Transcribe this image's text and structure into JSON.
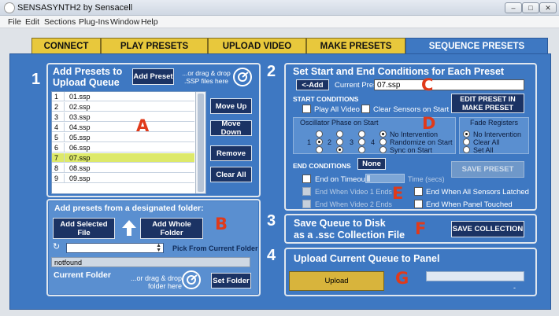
{
  "window": {
    "title": "SENSASYNTH2 by Sensacell"
  },
  "menu": [
    "File",
    "Edit",
    "Sections",
    "Plug-Ins",
    "Window",
    "Help"
  ],
  "tabs": [
    "CONNECT",
    "PLAY PRESETS",
    "UPLOAD VIDEO",
    "MAKE PRESETS",
    "SEQUENCE PRESETS"
  ],
  "section1": {
    "number": "1",
    "title": "Add Presets to Upload Queue",
    "add_preset": "Add Preset",
    "drag_hint": "...or drag & drop .SSP  files here",
    "letter": "A",
    "rows": [
      {
        "idx": "1",
        "name": "01.ssp"
      },
      {
        "idx": "2",
        "name": "02.ssp"
      },
      {
        "idx": "3",
        "name": "03.ssp"
      },
      {
        "idx": "4",
        "name": "04.ssp"
      },
      {
        "idx": "5",
        "name": "05.ssp"
      },
      {
        "idx": "6",
        "name": "06.ssp"
      },
      {
        "idx": "7",
        "name": "07.ssp"
      },
      {
        "idx": "8",
        "name": "08.ssp"
      },
      {
        "idx": "9",
        "name": "09.ssp"
      }
    ],
    "move_up": "Move Up",
    "move_down": "Move Down",
    "remove": "Remove",
    "clear_all": "Clear All",
    "folder_title": "Add presets from a designated  folder:",
    "add_selected": "Add Selected File",
    "add_whole": "Add Whole Folder",
    "letter_b": "B",
    "pick_label": "Pick From Current Folder",
    "current_folder_value": "notfound",
    "current_folder_label": "Current   Folder",
    "folder_drag_hint": "...or drag & drop folder here",
    "set_folder": "Set Folder"
  },
  "section2": {
    "number": "2",
    "title": "Set Start and End Conditions for Each Preset",
    "add_btn": "<-Add",
    "current_preset_label": "Current Preset",
    "current_preset_value": "07.ssp",
    "letter_c": "C",
    "start_conditions": "START CONDITIONS",
    "play_all_video": "Play All Video",
    "clear_sensors": "Clear Sensors on Start",
    "edit_preset": "EDIT PRESET IN MAKE PRESET",
    "osc_title": "Oscillator Phase on Start",
    "osc_labels": [
      "1",
      "2",
      "3",
      "4"
    ],
    "osc_opts": [
      "No Intervention",
      "Randomize on Start",
      "Sync on Start"
    ],
    "letter_d": "D",
    "fade_title": "Fade Registers",
    "fade_opts": [
      "No Intervention",
      "Clear All",
      "Set All"
    ],
    "end_conditions": "END CONDITIONS",
    "end_value": "None",
    "end_timeout": "End on Timeout",
    "time_label": "Time (secs)",
    "save_preset": "SAVE PRESET",
    "video1_ends": "End When Video 1 Ends",
    "video2_ends": "End When Video 2 Ends",
    "letter_e": "E",
    "sensors_latched": "End When All Sensors Latched",
    "panel_touched": "End When Panel Touched"
  },
  "section3": {
    "number": "3",
    "title_line1": "Save Queue to Disk",
    "title_line2": "as a .ssc Collection File",
    "letter_f": "F",
    "save_collection": "SAVE COLLECTION"
  },
  "section4": {
    "number": "4",
    "title": "Upload Current Queue to Panel",
    "upload": "Upload",
    "letter_g": "G",
    "progress": 0,
    "dash": "-"
  }
}
